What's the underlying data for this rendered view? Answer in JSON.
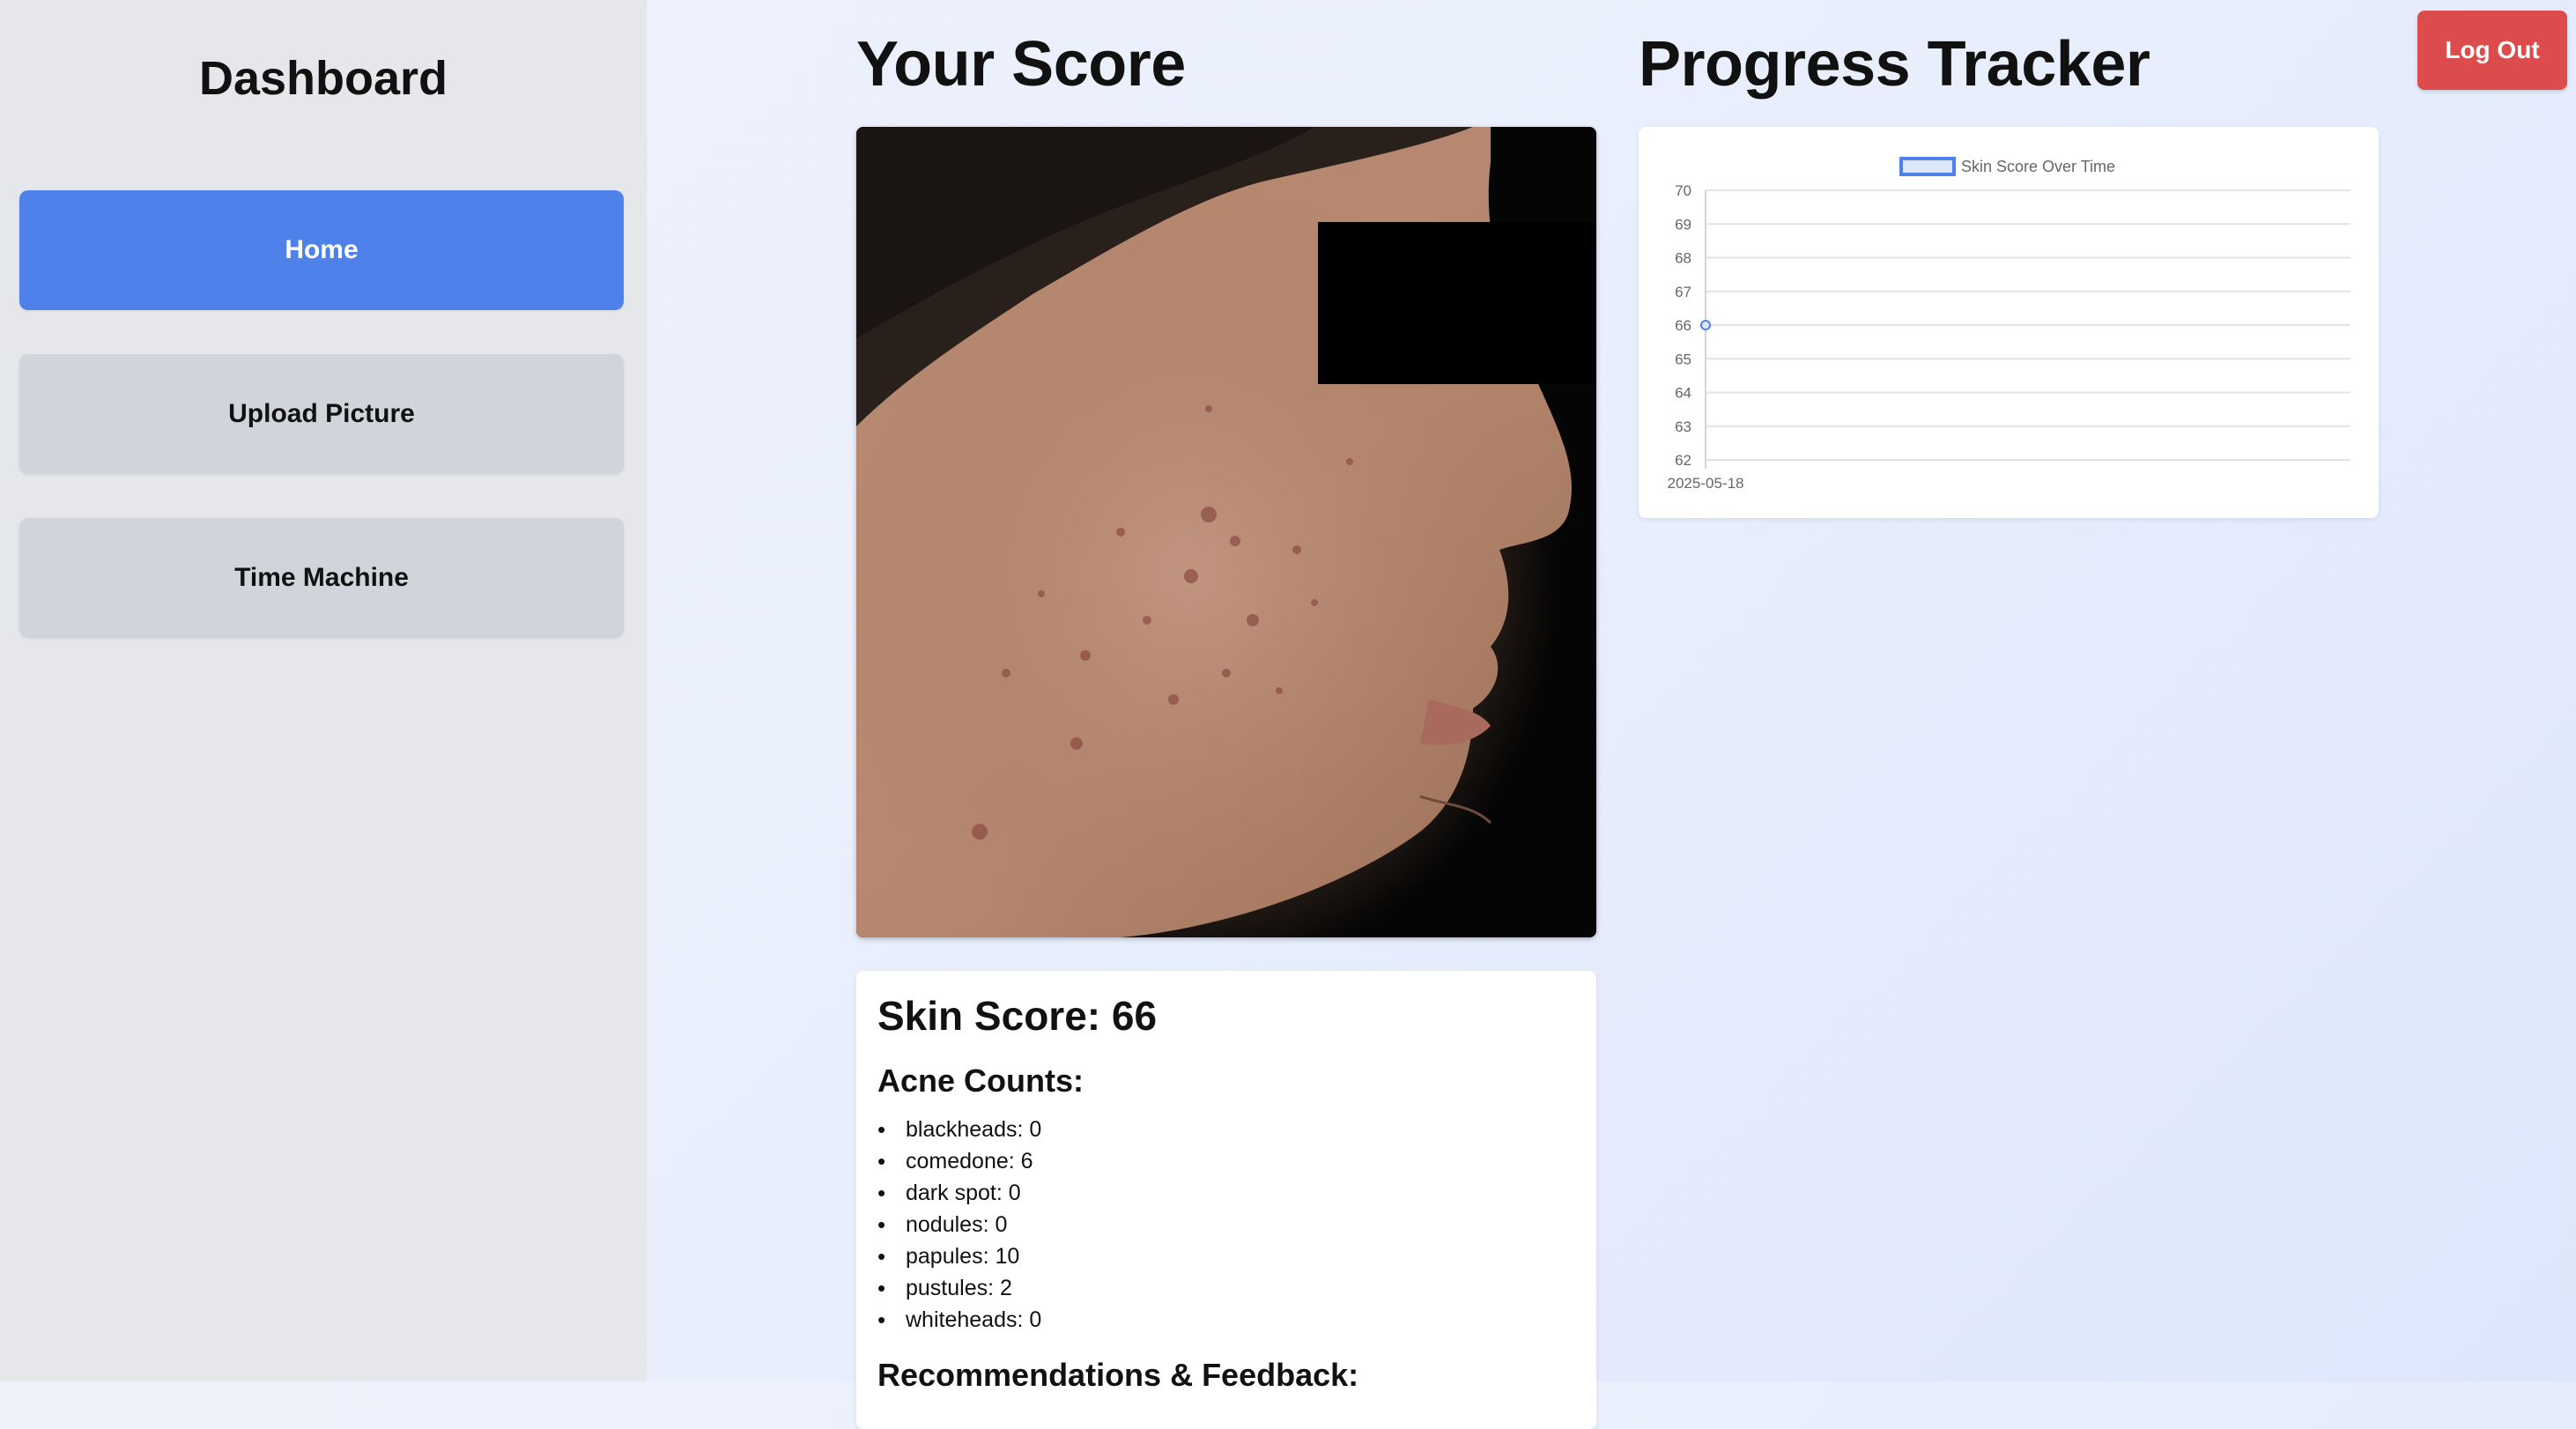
{
  "sidebar": {
    "title": "Dashboard",
    "items": [
      {
        "label": "Home",
        "active": true
      },
      {
        "label": "Upload Picture",
        "active": false
      },
      {
        "label": "Time Machine",
        "active": false
      }
    ]
  },
  "header": {
    "logout_label": "Log Out"
  },
  "score_section": {
    "title": "Your Score",
    "photo_alt": "skin photo",
    "skin_score_label": "Skin Score: 66",
    "skin_score": 66,
    "acne_counts_title": "Acne Counts:",
    "acne_counts": [
      "blackheads: 0",
      "comedone: 6",
      "dark spot: 0",
      "nodules: 0",
      "papules: 10",
      "pustules: 2",
      "whiteheads: 0"
    ],
    "recommendations_title": "Recommendations & Feedback:"
  },
  "progress_section": {
    "title": "Progress Tracker"
  },
  "chart_data": {
    "type": "line",
    "x": [
      "2025-05-18"
    ],
    "series": [
      {
        "name": "Skin Score Over Time",
        "values": [
          66
        ]
      }
    ],
    "yticks": [
      "62",
      "63",
      "64",
      "65",
      "66",
      "67",
      "68",
      "69",
      "70"
    ],
    "ylim": [
      62,
      70
    ],
    "legend": "top-center",
    "grid": true
  },
  "colors": {
    "primary": "#4f81ea",
    "danger": "#dc4c4c",
    "sidebar_bg": "#e5e7eb",
    "nav_inactive": "#d1d5db"
  }
}
